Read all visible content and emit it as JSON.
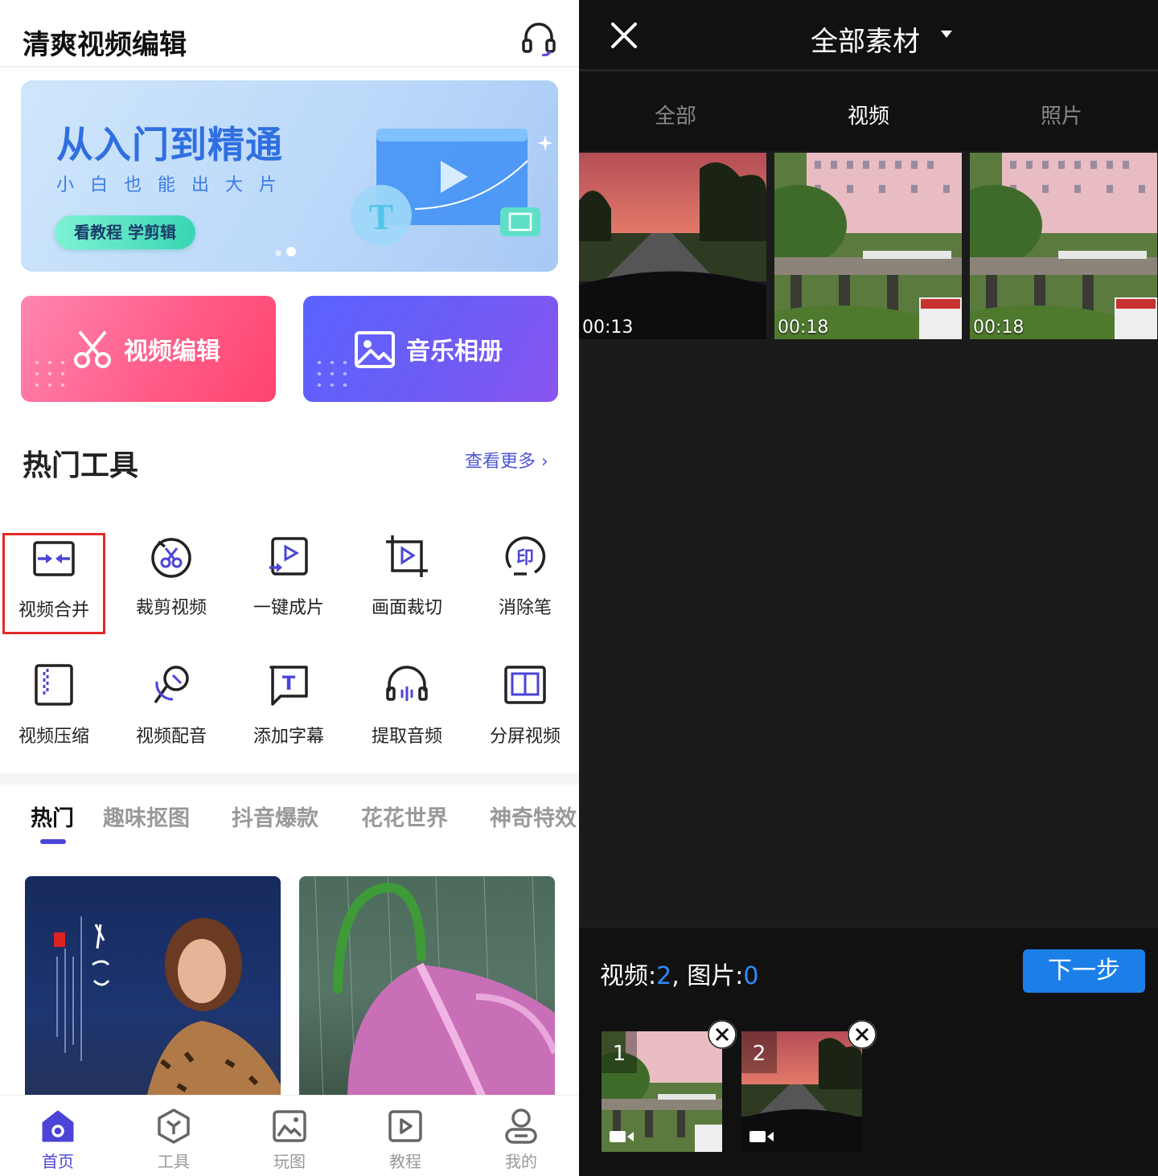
{
  "left": {
    "app_title": "清爽视频编辑",
    "banner": {
      "title": "从入门到精通",
      "subtitle": "小白也能出大片",
      "button": "看教程 学剪辑"
    },
    "features": [
      {
        "label": "视频编辑",
        "icon": "scissors-icon"
      },
      {
        "label": "音乐相册",
        "icon": "image-icon"
      }
    ],
    "hot_tools": {
      "title": "热门工具",
      "more": "查看更多 ›",
      "items": [
        {
          "label": "视频合并",
          "icon": "merge-icon"
        },
        {
          "label": "裁剪视频",
          "icon": "cut-video-icon"
        },
        {
          "label": "一键成片",
          "icon": "one-click-icon"
        },
        {
          "label": "画面裁切",
          "icon": "crop-icon"
        },
        {
          "label": "消除笔",
          "icon": "eraser-icon"
        },
        {
          "label": "视频压缩",
          "icon": "compress-icon"
        },
        {
          "label": "视频配音",
          "icon": "dubbing-icon"
        },
        {
          "label": "添加字幕",
          "icon": "subtitle-icon"
        },
        {
          "label": "提取音频",
          "icon": "extract-audio-icon"
        },
        {
          "label": "分屏视频",
          "icon": "split-screen-icon"
        }
      ]
    },
    "categories": [
      "热门",
      "趣味抠图",
      "抖音爆款",
      "花花世界",
      "神奇特效"
    ],
    "active_category": "热门",
    "bottom_nav": [
      {
        "label": "首页",
        "icon": "home-icon",
        "active": true
      },
      {
        "label": "工具",
        "icon": "tools-icon"
      },
      {
        "label": "玩图",
        "icon": "picture-icon"
      },
      {
        "label": "教程",
        "icon": "tutorial-icon"
      },
      {
        "label": "我的",
        "icon": "profile-icon"
      }
    ],
    "accent": "#4b44d6"
  },
  "right": {
    "title": "全部素材",
    "tabs": [
      "全部",
      "视频",
      "照片"
    ],
    "active_tab": "视频",
    "thumbnails": [
      {
        "duration": "00:13"
      },
      {
        "duration": "00:18"
      },
      {
        "duration": "00:18"
      }
    ],
    "selection": {
      "video_label": "视频:",
      "video_count": "2",
      "sep": ",",
      "image_label": " 图片:",
      "image_count": "0",
      "next": "下一步",
      "items": [
        {
          "index": "1"
        },
        {
          "index": "2"
        }
      ]
    },
    "accent": "#1c7fe8"
  }
}
